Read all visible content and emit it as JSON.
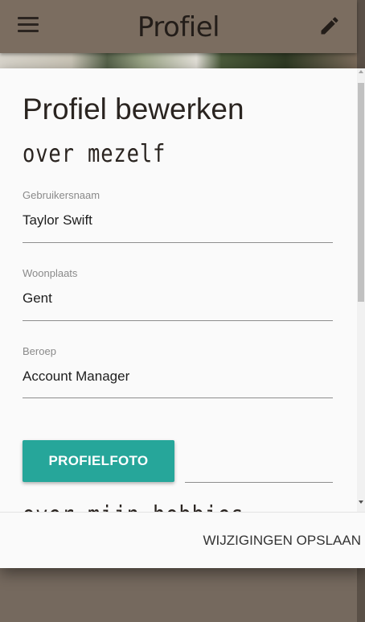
{
  "appbar": {
    "title": "Profiel",
    "menu_icon": "hamburger-menu-icon",
    "edit_icon": "pencil-icon"
  },
  "dialog": {
    "title": "Profiel bewerken",
    "section_about": "over mezelf",
    "fields": [
      {
        "label": "Gebruikersnaam",
        "value": "Taylor Swift"
      },
      {
        "label": "Woonplaats",
        "value": "Gent"
      },
      {
        "label": "Beroep",
        "value": "Account Manager"
      }
    ],
    "photo_button": "PROFIELFOTO",
    "section_next": "over mijn hobbies",
    "save_button": "WIJZIGINGEN OPSLAAN"
  },
  "colors": {
    "appbar": "#7b6d60",
    "accent": "#26a69a",
    "dialog_bg": "#fafafa"
  }
}
